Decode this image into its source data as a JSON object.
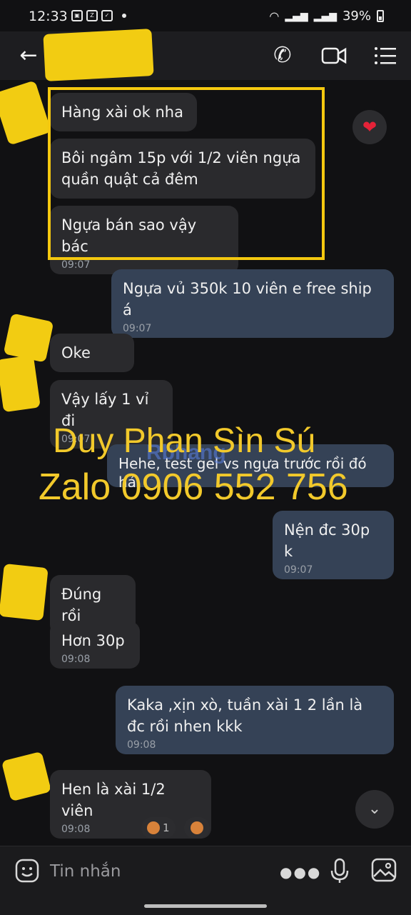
{
  "status_bar": {
    "time": "12:33",
    "battery": "39%"
  },
  "header": {
    "back_icon": "arrow-left-icon",
    "call_icon": "phone-icon",
    "video_icon": "video-camera-icon",
    "menu_icon": "list-menu-icon"
  },
  "messages": [
    {
      "text": "Hàng xài ok nha",
      "time": ""
    },
    {
      "text": "Bôi ngâm 15p với 1/2 viên ngựa quần quật cả đêm",
      "time": ""
    },
    {
      "text": "Ngựa bán sao vậy bác",
      "time": "09:07"
    },
    {
      "text": "Ngựa vủ 350k 10 viên e free ship á",
      "time": "09:07"
    },
    {
      "text": "Oke",
      "time": ""
    },
    {
      "text": "Vậy lấy 1 vỉ đi",
      "time": "09:07"
    },
    {
      "text": "Hehe, test gel vs ngựa trước rồi đó hả",
      "time": ""
    },
    {
      "text": "Nện đc 30p k",
      "time": "09:07"
    },
    {
      "text": "Đúng rồi",
      "time": ""
    },
    {
      "text": "Hơn 30p",
      "time": "09:08"
    },
    {
      "text": "Kaka ,xịn xò, tuần xài 1 2 lần là đc rồi nhen kkk",
      "time": "09:08"
    },
    {
      "text": "Hen là xài 1/2 viên",
      "time": "09:08"
    }
  ],
  "reaction_count": "1",
  "watermark": {
    "line1": "Duy Phan Sìn Sú",
    "line2": "Zalo 0906 552 756",
    "logo": "Rbhang"
  },
  "input": {
    "placeholder": "Tin nhắn"
  },
  "colors": {
    "incoming": "#2a2a2d",
    "outgoing": "#354256",
    "highlight": "#f4c80f",
    "watermark": "#f2c92b"
  }
}
